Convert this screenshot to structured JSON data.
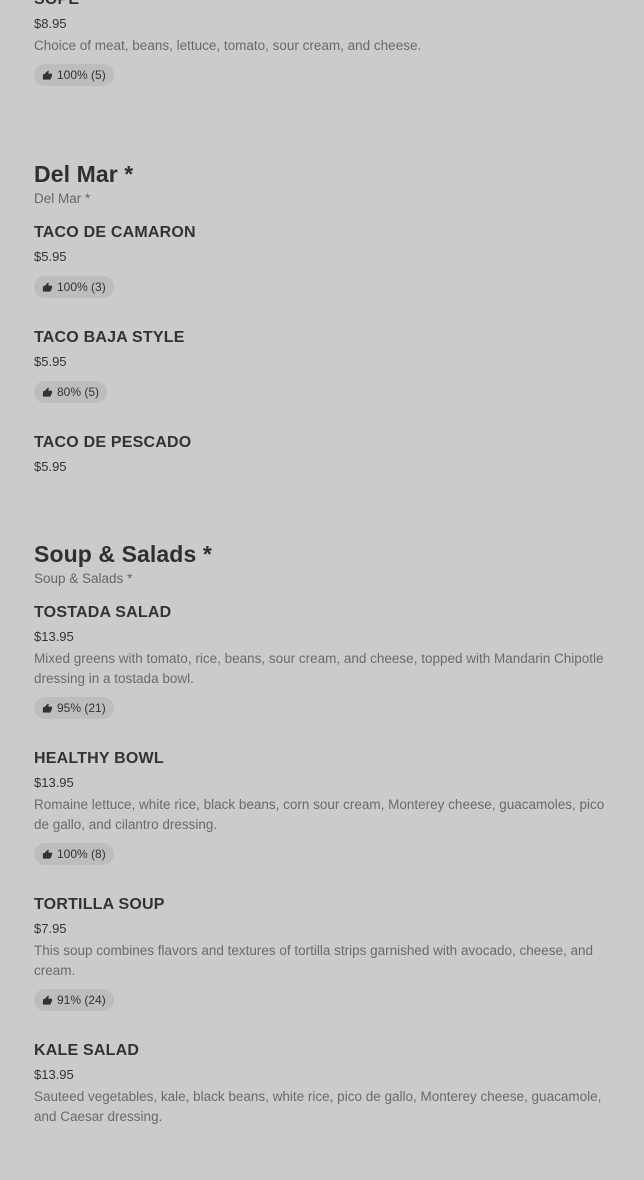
{
  "sections": [
    {
      "title": "",
      "subtitle": "",
      "items": [
        {
          "name": "SOPE",
          "price": "$8.95",
          "description": "Choice of meat, beans, lettuce, tomato, sour cream, and cheese.",
          "rating": "100% (5)"
        }
      ]
    },
    {
      "title": "Del Mar *",
      "subtitle": "Del Mar *",
      "items": [
        {
          "name": "TACO DE CAMARON",
          "price": "$5.95",
          "description": "",
          "rating": "100% (3)"
        },
        {
          "name": "TACO BAJA STYLE",
          "price": "$5.95",
          "description": "",
          "rating": "80% (5)"
        },
        {
          "name": "TACO DE PESCADO",
          "price": "$5.95",
          "description": "",
          "rating": ""
        }
      ]
    },
    {
      "title": "Soup & Salads *",
      "subtitle": "Soup & Salads *",
      "items": [
        {
          "name": "TOSTADA SALAD",
          "price": "$13.95",
          "description": "Mixed greens with tomato, rice, beans, sour cream, and cheese, topped with Mandarin Chipotle dressing in a tostada bowl.",
          "rating": "95% (21)"
        },
        {
          "name": "HEALTHY BOWL",
          "price": "$13.95",
          "description": "Romaine lettuce, white rice, black beans, corn sour cream, Monterey cheese, guacamoles, pico de gallo, and cilantro dressing.",
          "rating": "100% (8)"
        },
        {
          "name": "TORTILLA SOUP",
          "price": "$7.95",
          "description": "This soup combines flavors and textures of tortilla strips garnished with avocado, cheese, and cream.",
          "rating": "91% (24)"
        },
        {
          "name": "KALE SALAD",
          "price": "$13.95",
          "description": "Sauteed vegetables, kale, black beans, white rice, pico de gallo, Monterey cheese, guacamole, and Caesar dressing.",
          "rating": ""
        }
      ]
    }
  ],
  "icons": {
    "rating": "thumbs-up-icon"
  },
  "colors": {
    "background": "#cbcbcb",
    "pill": "#bdbdbd",
    "text": "#333333",
    "muted": "#6a6a6a"
  }
}
